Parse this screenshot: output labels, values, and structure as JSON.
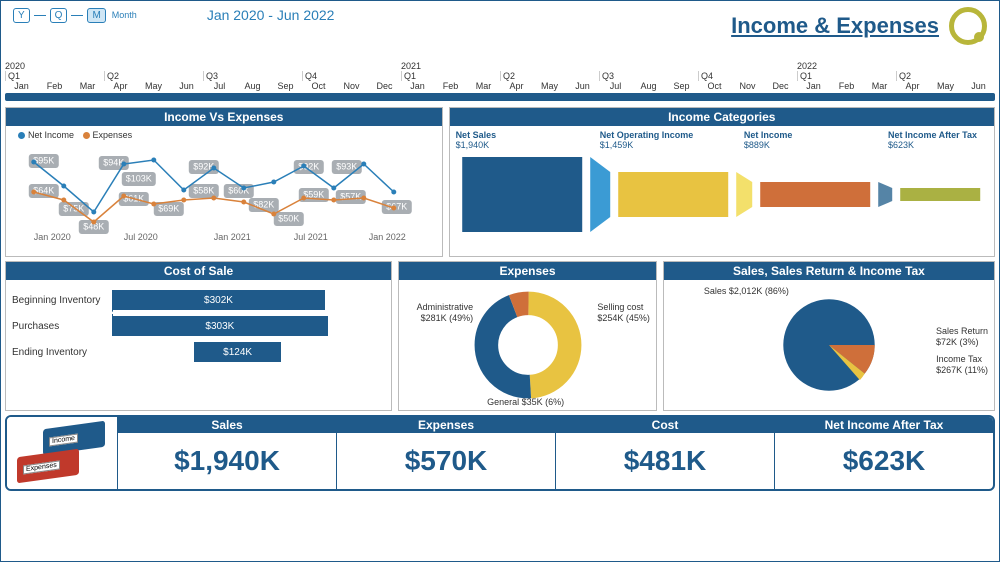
{
  "header": {
    "period_toggle": {
      "y": "Y",
      "q": "Q",
      "m": "M",
      "label": "Month"
    },
    "date_range": "Jan 2020 - Jun 2022",
    "title": "Income & Expenses"
  },
  "timeline": {
    "years": [
      "2020",
      "2021",
      "2022"
    ],
    "quarters": [
      "Q1",
      "Q2",
      "Q3",
      "Q4",
      "Q1",
      "Q2",
      "Q3",
      "Q4",
      "Q1",
      "Q2"
    ],
    "months": [
      "Jan",
      "Feb",
      "Mar",
      "Apr",
      "May",
      "Jun",
      "Jul",
      "Aug",
      "Sep",
      "Oct",
      "Nov",
      "Dec",
      "Jan",
      "Feb",
      "Mar",
      "Apr",
      "May",
      "Jun",
      "Jul",
      "Aug",
      "Sep",
      "Oct",
      "Nov",
      "Dec",
      "Jan",
      "Feb",
      "Mar",
      "Apr",
      "May",
      "Jun"
    ]
  },
  "income_vs_expenses": {
    "title": "Income Vs Expenses",
    "legend": {
      "a": "Net Income",
      "b": "Expenses"
    },
    "xticks": [
      "Jan 2020",
      "Jul 2020",
      "Jan 2021",
      "Jul 2021",
      "Jan 2022"
    ]
  },
  "income_categories": {
    "title": "Income Categories",
    "items": [
      {
        "name": "Net Sales",
        "value": "$1,940K"
      },
      {
        "name": "Net Operating Income",
        "value": "$1,459K"
      },
      {
        "name": "Net Income",
        "value": "$889K"
      },
      {
        "name": "Net Income After Tax",
        "value": "$623K"
      }
    ]
  },
  "cost_of_sale": {
    "title": "Cost of Sale",
    "rows": [
      {
        "label": "Beginning Inventory",
        "value": "$302K"
      },
      {
        "label": "Purchases",
        "value": "$303K"
      },
      {
        "label": "Ending Inventory",
        "value": "$124K"
      }
    ]
  },
  "expenses": {
    "title": "Expenses",
    "slices": {
      "admin": {
        "label": "Administrative",
        "value": "$281K (49%)"
      },
      "selling": {
        "label": "Selling cost",
        "value": "$254K (45%)"
      },
      "general": {
        "label": "General $35K (6%)"
      }
    }
  },
  "sales_pie": {
    "title": "Sales, Sales Return & Income Tax",
    "labels": {
      "sales": "Sales $2,012K (86%)",
      "return_name": "Sales Return",
      "return_val": "$72K (3%)",
      "tax_name": "Income Tax",
      "tax_val": "$267K (11%)"
    }
  },
  "summary": {
    "binders": {
      "income": "Income",
      "expenses": "Expenses"
    },
    "cells": [
      {
        "h": "Sales",
        "v": "$1,940K"
      },
      {
        "h": "Expenses",
        "v": "$570K"
      },
      {
        "h": "Cost",
        "v": "$481K"
      },
      {
        "h": "Net Income After Tax",
        "v": "$623K"
      }
    ]
  },
  "chart_data": [
    {
      "name": "Income Vs Expenses",
      "type": "line",
      "x": [
        "Jan 2020",
        "Apr 2020",
        "Jul 2020",
        "Oct 2020",
        "Jan 2021",
        "Apr 2021",
        "Jul 2021",
        "Oct 2021",
        "Jan 2022",
        "Apr 2022"
      ],
      "series": [
        {
          "name": "Net Income",
          "values": [
            95,
            64,
            94,
            103,
            61,
            58,
            60,
            82,
            92,
            59,
            92,
            93,
            57,
            67
          ],
          "labels": [
            "$95K",
            "$64K",
            "$94K",
            "$103K",
            "$61K",
            "$58K",
            "$60K",
            "$82K",
            "$92K",
            "$59K",
            "$92K",
            "$93K",
            "$57K",
            "$67K"
          ]
        },
        {
          "name": "Expenses",
          "values": [
            64,
            75,
            48,
            61,
            69,
            58,
            60,
            50,
            59,
            57,
            67
          ]
        }
      ],
      "ylim": [
        40,
        110
      ]
    },
    {
      "name": "Income Categories",
      "type": "funnel",
      "categories": [
        "Net Sales",
        "Net Operating Income",
        "Net Income",
        "Net Income After Tax"
      ],
      "values": [
        1940,
        1459,
        889,
        623
      ]
    },
    {
      "name": "Cost of Sale",
      "type": "bar",
      "orientation": "h",
      "categories": [
        "Beginning Inventory",
        "Purchases",
        "Ending Inventory"
      ],
      "values": [
        302,
        303,
        124
      ]
    },
    {
      "name": "Expenses",
      "type": "pie",
      "subtype": "donut",
      "categories": [
        "Administrative",
        "Selling cost",
        "General"
      ],
      "values": [
        281,
        254,
        35
      ],
      "percent": [
        49,
        45,
        6
      ]
    },
    {
      "name": "Sales, Sales Return & Income Tax",
      "type": "pie",
      "categories": [
        "Sales",
        "Sales Return",
        "Income Tax"
      ],
      "values": [
        2012,
        72,
        267
      ],
      "percent": [
        86,
        3,
        11
      ]
    }
  ]
}
